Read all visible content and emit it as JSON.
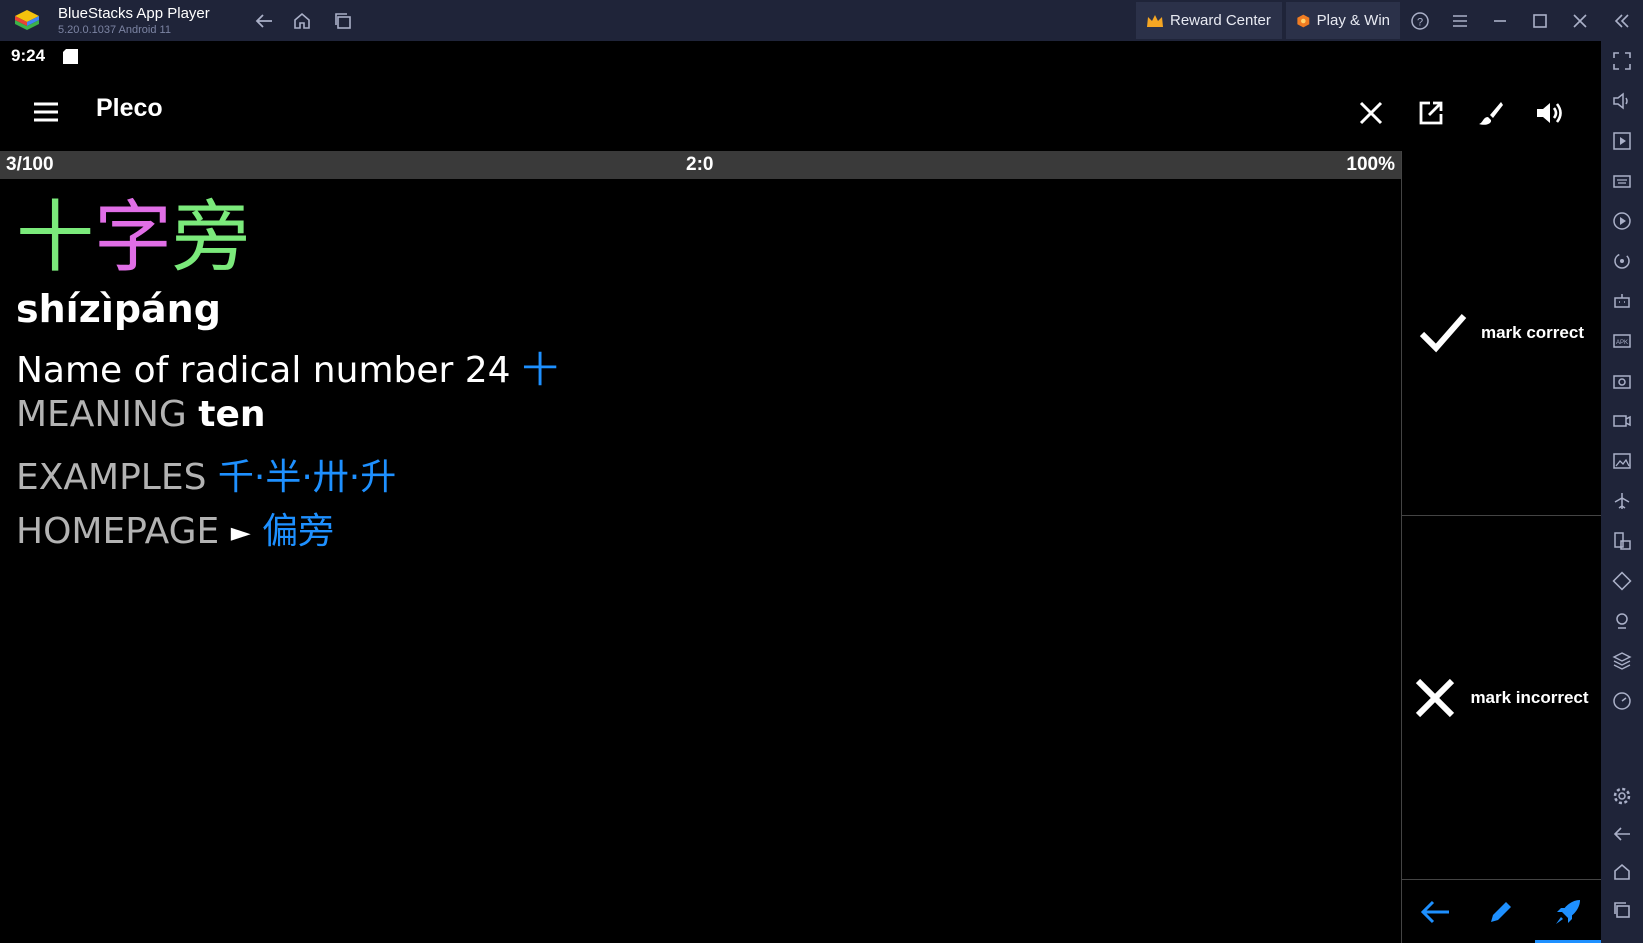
{
  "titlebar": {
    "app_name": "BlueStacks App Player",
    "version": "5.20.0.1037  Android 11",
    "reward_center": "Reward Center",
    "play_win": "Play & Win"
  },
  "status": {
    "time": "9:24"
  },
  "appbar": {
    "title": "Pleco"
  },
  "progress": {
    "count": "3/100",
    "score": "2:0",
    "percent": "100%"
  },
  "card": {
    "headword": [
      "十",
      "字",
      "旁"
    ],
    "headword_colors": [
      "#7bea7b",
      "#e06ee6",
      "#7bea7b"
    ],
    "pinyin": "shízìpáng",
    "definition": "Name of radical number 24",
    "definition_char": "十",
    "meaning_label": "MEANING",
    "meaning_value": "ten",
    "examples_label": "EXAMPLES",
    "examples": "千·半·卅·升",
    "homepage_label": "HOMEPAGE",
    "homepage_arrow": "►",
    "homepage_value": "偏旁"
  },
  "side": {
    "correct": "mark correct",
    "incorrect": "mark incorrect"
  },
  "colors": {
    "accent": "#1e90ff",
    "titlebar": "#1f2439"
  }
}
